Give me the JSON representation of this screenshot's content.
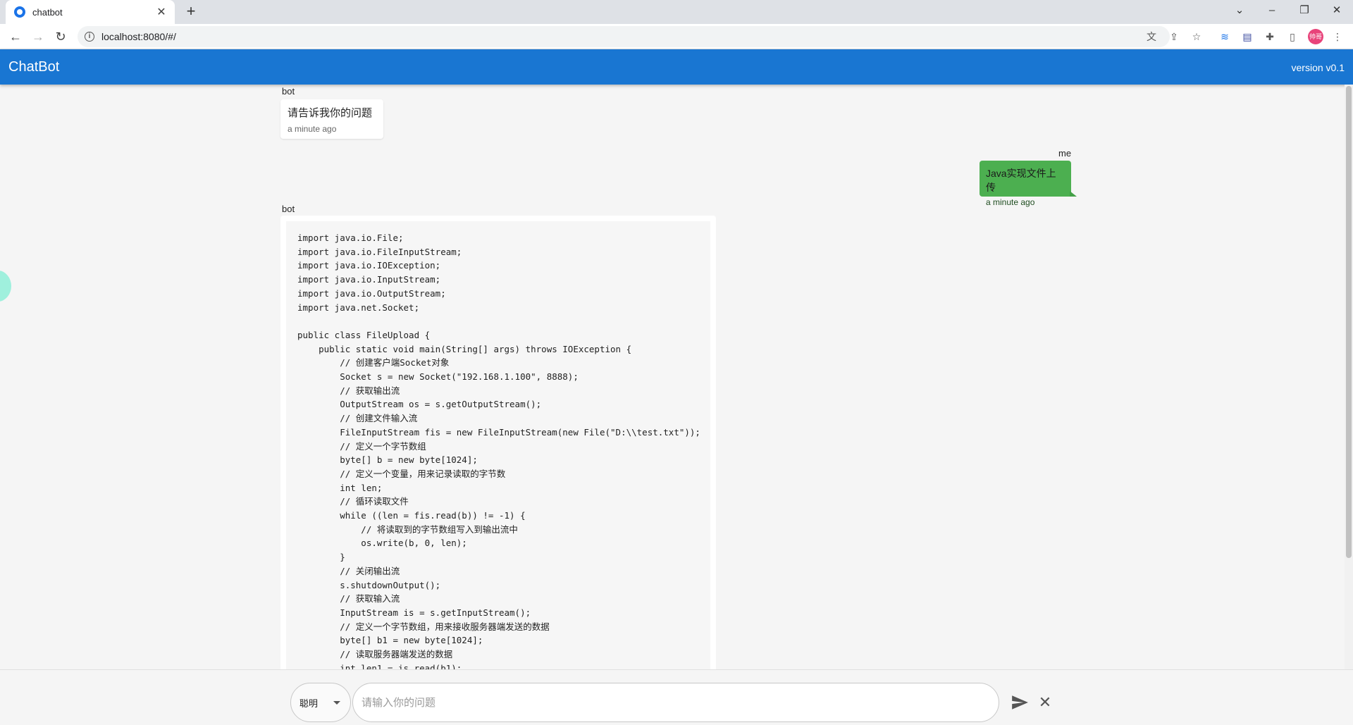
{
  "browser": {
    "tab_title": "chatbot",
    "tab_close": "✕",
    "new_tab": "+",
    "url": "localhost:8080/#/",
    "profile_label": "帅哥"
  },
  "app": {
    "brand": "ChatBot",
    "version": "version v0.1"
  },
  "messages": [
    {
      "sender": "bot",
      "text": "请告诉我你的问题",
      "time": "a minute ago"
    },
    {
      "sender": "me",
      "text": "Java实现文件上传",
      "time": "a minute ago"
    },
    {
      "sender": "bot",
      "code": "import java.io.File;\nimport java.io.FileInputStream;\nimport java.io.IOException;\nimport java.io.InputStream;\nimport java.io.OutputStream;\nimport java.net.Socket;\n\npublic class FileUpload {\n    public static void main(String[] args) throws IOException {\n        // 创建客户端Socket对象\n        Socket s = new Socket(\"192.168.1.100\", 8888);\n        // 获取输出流\n        OutputStream os = s.getOutputStream();\n        // 创建文件输入流\n        FileInputStream fis = new FileInputStream(new File(\"D:\\\\test.txt\"));\n        // 定义一个字节数组\n        byte[] b = new byte[1024];\n        // 定义一个变量，用来记录读取的字节数\n        int len;\n        // 循环读取文件\n        while ((len = fis.read(b)) != -1) {\n            // 将读取到的字节数组写入到输出流中\n            os.write(b, 0, len);\n        }\n        // 关闭输出流\n        s.shutdownOutput();\n        // 获取输入流\n        InputStream is = s.getInputStream();\n        // 定义一个字节数组，用来接收服务器端发送的数据\n        byte[] b1 = new byte[1024];\n        // 读取服务器端发送的数据\n        int len1 = is.read(b1);"
    }
  ],
  "input": {
    "model": "聪明",
    "placeholder": "请输入你的问题",
    "value": ""
  }
}
